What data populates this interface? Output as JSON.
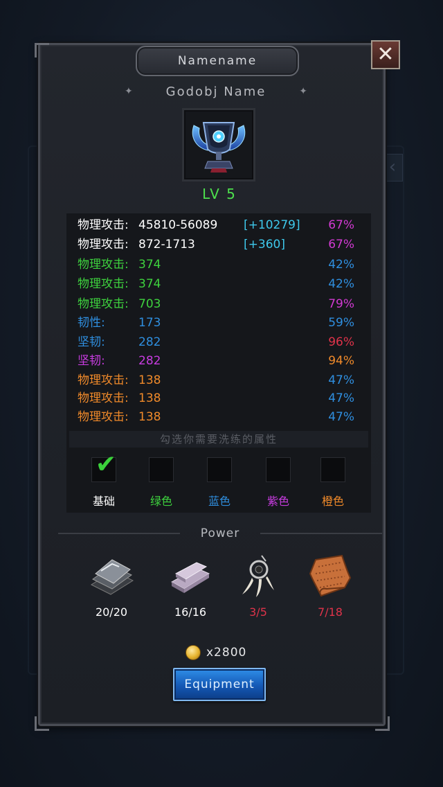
{
  "window": {
    "title": "Namename",
    "close_label": "✕"
  },
  "item": {
    "name": "Godobj Name",
    "level": "LV 5",
    "icon": "trophy-cup-icon"
  },
  "stats": [
    {
      "label": "物理攻击:",
      "value": "45810-56089",
      "bonus": "[+10279]",
      "percent": "67%",
      "label_color": "#ffffff",
      "percent_color": "#d23ad2"
    },
    {
      "label": "物理攻击:",
      "value": "872-1713",
      "bonus": "[+360]",
      "percent": "67%",
      "label_color": "#ffffff",
      "percent_color": "#d23ad2"
    },
    {
      "label": "物理攻击:",
      "value": "374",
      "bonus": "",
      "percent": "42%",
      "label_color": "#3ed23e",
      "percent_color": "#2f8fe0"
    },
    {
      "label": "物理攻击:",
      "value": "374",
      "bonus": "",
      "percent": "42%",
      "label_color": "#3ed23e",
      "percent_color": "#2f8fe0"
    },
    {
      "label": "物理攻击:",
      "value": "703",
      "bonus": "",
      "percent": "79%",
      "label_color": "#3ed23e",
      "percent_color": "#d23ad2"
    },
    {
      "label": "韧性:",
      "value": "173",
      "bonus": "",
      "percent": "59%",
      "label_color": "#2f8fe0",
      "percent_color": "#2f8fe0"
    },
    {
      "label": "坚韧:",
      "value": "282",
      "bonus": "",
      "percent": "96%",
      "label_color": "#2f8fe0",
      "percent_color": "#e0334a"
    },
    {
      "label": "坚韧:",
      "value": "282",
      "bonus": "",
      "percent": "94%",
      "label_color": "#c83ce0",
      "percent_color": "#f08a2a"
    },
    {
      "label": "物理攻击:",
      "value": "138",
      "bonus": "",
      "percent": "47%",
      "label_color": "#f08a2a",
      "percent_color": "#2f8fe0"
    },
    {
      "label": "物理攻击:",
      "value": "138",
      "bonus": "",
      "percent": "47%",
      "label_color": "#f08a2a",
      "percent_color": "#2f8fe0"
    },
    {
      "label": "物理攻击:",
      "value": "138",
      "bonus": "",
      "percent": "47%",
      "label_color": "#f08a2a",
      "percent_color": "#2f8fe0"
    }
  ],
  "hint": "勾选你需要洗练的属性",
  "filters": [
    {
      "label": "基础",
      "checked": true,
      "color": "#ffffff"
    },
    {
      "label": "绿色",
      "checked": false,
      "color": "#3ed23e"
    },
    {
      "label": "蓝色",
      "checked": false,
      "color": "#2f8fe0"
    },
    {
      "label": "紫色",
      "checked": false,
      "color": "#c83ce0"
    },
    {
      "label": "橙色",
      "checked": false,
      "color": "#f08a2a"
    }
  ],
  "power": {
    "title": "Power",
    "materials": [
      {
        "icon": "iron-plates-icon",
        "count": "20/20",
        "color": "#ffffff"
      },
      {
        "icon": "silver-ingots-icon",
        "count": "16/16",
        "color": "#ffffff"
      },
      {
        "icon": "fang-charm-icon",
        "count": "3/5",
        "color": "#e0334a"
      },
      {
        "icon": "leather-scroll-icon",
        "count": "7/18",
        "color": "#e0334a"
      }
    ]
  },
  "cost": {
    "icon": "gold-coin-icon",
    "amount": "x2800"
  },
  "action": {
    "label": "Equipment"
  }
}
